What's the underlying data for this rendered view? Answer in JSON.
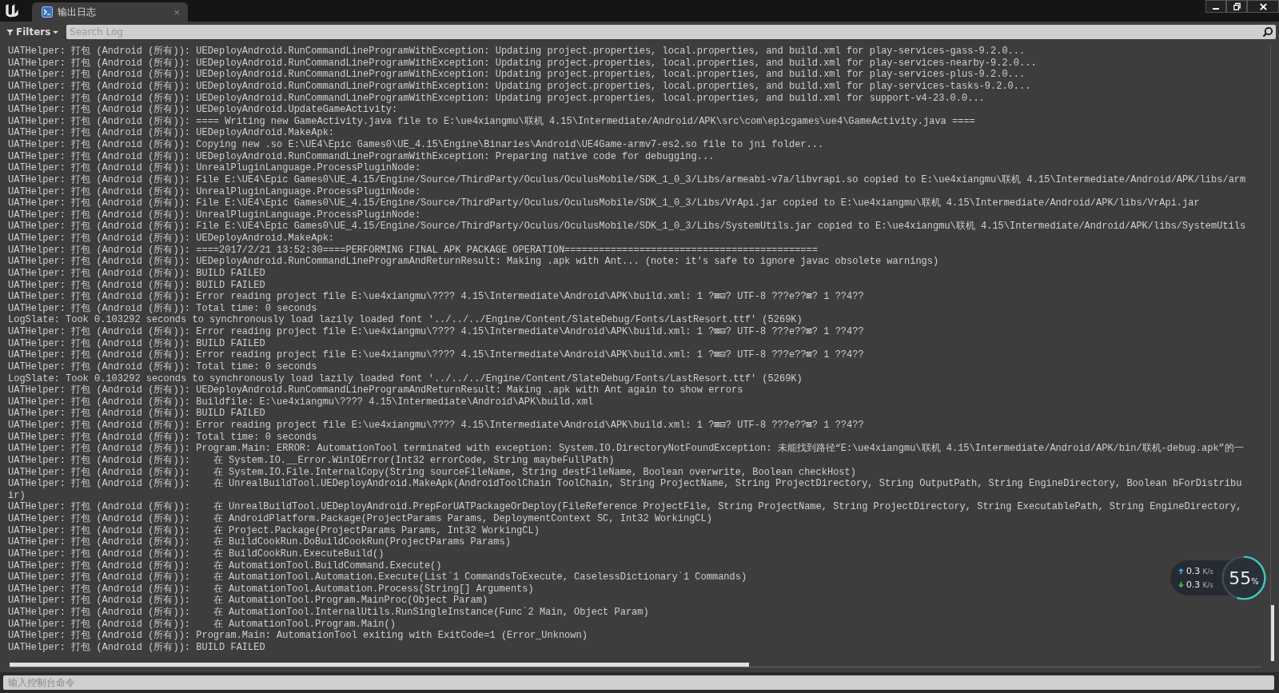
{
  "tab": {
    "title": "输出日志",
    "close": "×",
    "selected": true
  },
  "toolbar": {
    "filters": "Filters",
    "search": {
      "placeholder": "Search Log"
    }
  },
  "log_lines": [
    "UATHelper: 打包 (Android (所有)): UEDeployAndroid.RunCommandLineProgramWithException: Updating project.properties, local.properties, and build.xml for play-services-gass-9.2.0...",
    "UATHelper: 打包 (Android (所有)): UEDeployAndroid.RunCommandLineProgramWithException: Updating project.properties, local.properties, and build.xml for play-services-nearby-9.2.0...",
    "UATHelper: 打包 (Android (所有)): UEDeployAndroid.RunCommandLineProgramWithException: Updating project.properties, local.properties, and build.xml for play-services-plus-9.2.0...",
    "UATHelper: 打包 (Android (所有)): UEDeployAndroid.RunCommandLineProgramWithException: Updating project.properties, local.properties, and build.xml for play-services-tasks-9.2.0...",
    "UATHelper: 打包 (Android (所有)): UEDeployAndroid.RunCommandLineProgramWithException: Updating project.properties, local.properties, and build.xml for support-v4-23.0.0...",
    "UATHelper: 打包 (Android (所有)): UEDeployAndroid.UpdateGameActivity:",
    "UATHelper: 打包 (Android (所有)): ==== Writing new GameActivity.java file to E:\\ue4xiangmu\\联机 4.15\\Intermediate/Android/APK\\src\\com\\epicgames\\ue4\\GameActivity.java ====",
    "UATHelper: 打包 (Android (所有)): UEDeployAndroid.MakeApk:",
    "UATHelper: 打包 (Android (所有)): Copying new .so E:\\UE4\\Epic Games0\\UE_4.15\\Engine\\Binaries\\Android\\UE4Game-armv7-es2.so file to jni folder...",
    "UATHelper: 打包 (Android (所有)): UEDeployAndroid.RunCommandLineProgramWithException: Preparing native code for debugging...",
    "UATHelper: 打包 (Android (所有)): UnrealPluginLanguage.ProcessPluginNode:",
    "UATHelper: 打包 (Android (所有)): File E:\\UE4\\Epic Games0\\UE_4.15/Engine/Source/ThirdParty/Oculus/OculusMobile/SDK_1_0_3/Libs/armeabi-v7a/libvrapi.so copied to E:\\ue4xiangmu\\联机 4.15\\Intermediate/Android/APK/libs/arm",
    "UATHelper: 打包 (Android (所有)): UnrealPluginLanguage.ProcessPluginNode:",
    "UATHelper: 打包 (Android (所有)): File E:\\UE4\\Epic Games0\\UE_4.15/Engine/Source/ThirdParty/Oculus/OculusMobile/SDK_1_0_3/Libs/VrApi.jar copied to E:\\ue4xiangmu\\联机 4.15\\Intermediate/Android/APK/libs/VrApi.jar",
    "UATHelper: 打包 (Android (所有)): UnrealPluginLanguage.ProcessPluginNode:",
    "UATHelper: 打包 (Android (所有)): File E:\\UE4\\Epic Games0\\UE_4.15/Engine/Source/ThirdParty/Oculus/OculusMobile/SDK_1_0_3/Libs/SystemUtils.jar copied to E:\\ue4xiangmu\\联机 4.15\\Intermediate/Android/APK/libs/SystemUtils",
    "UATHelper: 打包 (Android (所有)): UEDeployAndroid.MakeApk:",
    "UATHelper: 打包 (Android (所有)): ====2017/2/21 13:52:30====PERFORMING FINAL APK PACKAGE OPERATION============================================",
    "UATHelper: 打包 (Android (所有)): UEDeployAndroid.RunCommandLineProgramAndReturnResult: Making .apk with Ant... (note: it's safe to ignore javac obsolete warnings)",
    "UATHelper: 打包 (Android (所有)): BUILD FAILED",
    "UATHelper: 打包 (Android (所有)): BUILD FAILED",
    "UATHelper: 打包 (Android (所有)): Error reading project file E:\\ue4xiangmu\\???? 4.15\\Intermediate\\Android\\APK\\build.xml: 1 ?⊠⊟? UTF-8 ???e??⊠? 1 ??4??",
    "UATHelper: 打包 (Android (所有)): Total time: 0 seconds",
    "LogSlate: Took 0.103292 seconds to synchronously load lazily loaded font '../../../Engine/Content/SlateDebug/Fonts/LastResort.ttf' (5269K)",
    "UATHelper: 打包 (Android (所有)): Error reading project file E:\\ue4xiangmu\\???? 4.15\\Intermediate\\Android\\APK\\build.xml: 1 ?⊠⊟? UTF-8 ???e??⊠? 1 ??4??",
    "UATHelper: 打包 (Android (所有)): BUILD FAILED",
    "UATHelper: 打包 (Android (所有)): Error reading project file E:\\ue4xiangmu\\???? 4.15\\Intermediate\\Android\\APK\\build.xml: 1 ?⊠⊟? UTF-8 ???e??⊠? 1 ??4??",
    "UATHelper: 打包 (Android (所有)): Total time: 0 seconds",
    "LogSlate: Took 0.103292 seconds to synchronously load lazily loaded font '../../../Engine/Content/SlateDebug/Fonts/LastResort.ttf' (5269K)",
    "UATHelper: 打包 (Android (所有)): UEDeployAndroid.RunCommandLineProgramAndReturnResult: Making .apk with Ant again to show errors",
    "UATHelper: 打包 (Android (所有)): Buildfile: E:\\ue4xiangmu\\???? 4.15\\Intermediate\\Android\\APK\\build.xml",
    "UATHelper: 打包 (Android (所有)): BUILD FAILED",
    "UATHelper: 打包 (Android (所有)): Error reading project file E:\\ue4xiangmu\\???? 4.15\\Intermediate\\Android\\APK\\build.xml: 1 ?⊠⊟? UTF-8 ???e??⊠? 1 ??4??",
    "UATHelper: 打包 (Android (所有)): Total time: 0 seconds",
    "UATHelper: 打包 (Android (所有)): Program.Main: ERROR: AutomationTool terminated with exception: System.IO.DirectoryNotFoundException: 未能找到路径“E:\\ue4xiangmu\\联机 4.15\\Intermediate/Android/APK/bin/联机-debug.apk”的一",
    "UATHelper: 打包 (Android (所有)):    在 System.IO.__Error.WinIOError(Int32 errorCode, String maybeFullPath)",
    "UATHelper: 打包 (Android (所有)):    在 System.IO.File.InternalCopy(String sourceFileName, String destFileName, Boolean overwrite, Boolean checkHost)",
    "UATHelper: 打包 (Android (所有)):    在 UnrealBuildTool.UEDeployAndroid.MakeApk(AndroidToolChain ToolChain, String ProjectName, String ProjectDirectory, String OutputPath, String EngineDirectory, Boolean bForDistribu",
    "ir)",
    "UATHelper: 打包 (Android (所有)):    在 UnrealBuildTool.UEDeployAndroid.PrepForUATPackageOrDeploy(FileReference ProjectFile, String ProjectName, String ProjectDirectory, String ExecutablePath, String EngineDirectory,",
    "UATHelper: 打包 (Android (所有)):    在 AndroidPlatform.Package(ProjectParams Params, DeploymentContext SC, Int32 WorkingCL)",
    "UATHelper: 打包 (Android (所有)):    在 Project.Package(ProjectParams Params, Int32 WorkingCL)",
    "UATHelper: 打包 (Android (所有)):    在 BuildCookRun.DoBuildCookRun(ProjectParams Params)",
    "UATHelper: 打包 (Android (所有)):    在 BuildCookRun.ExecuteBuild()",
    "UATHelper: 打包 (Android (所有)):    在 AutomationTool.BuildCommand.Execute()",
    "UATHelper: 打包 (Android (所有)):    在 AutomationTool.Automation.Execute(List`1 CommandsToExecute, CaselessDictionary`1 Commands)",
    "UATHelper: 打包 (Android (所有)):    在 AutomationTool.Automation.Process(String[] Arguments)",
    "UATHelper: 打包 (Android (所有)):    在 AutomationTool.Program.MainProc(Object Param)",
    "UATHelper: 打包 (Android (所有)):    在 AutomationTool.InternalUtils.RunSingleInstance(Func`2 Main, Object Param)",
    "UATHelper: 打包 (Android (所有)):    在 AutomationTool.Program.Main()",
    "UATHelper: 打包 (Android (所有)): Program.Main: AutomationTool exiting with ExitCode=1 (Error_Unknown)",
    "UATHelper: 打包 (Android (所有)): BUILD FAILED"
  ],
  "console": {
    "placeholder": "输入控制台命令"
  },
  "net_widget": {
    "upload": {
      "value": "0.3",
      "unit": "K/s"
    },
    "download": {
      "value": "0.3",
      "unit": "K/s"
    },
    "percent": "55",
    "percent_sign": "%"
  }
}
